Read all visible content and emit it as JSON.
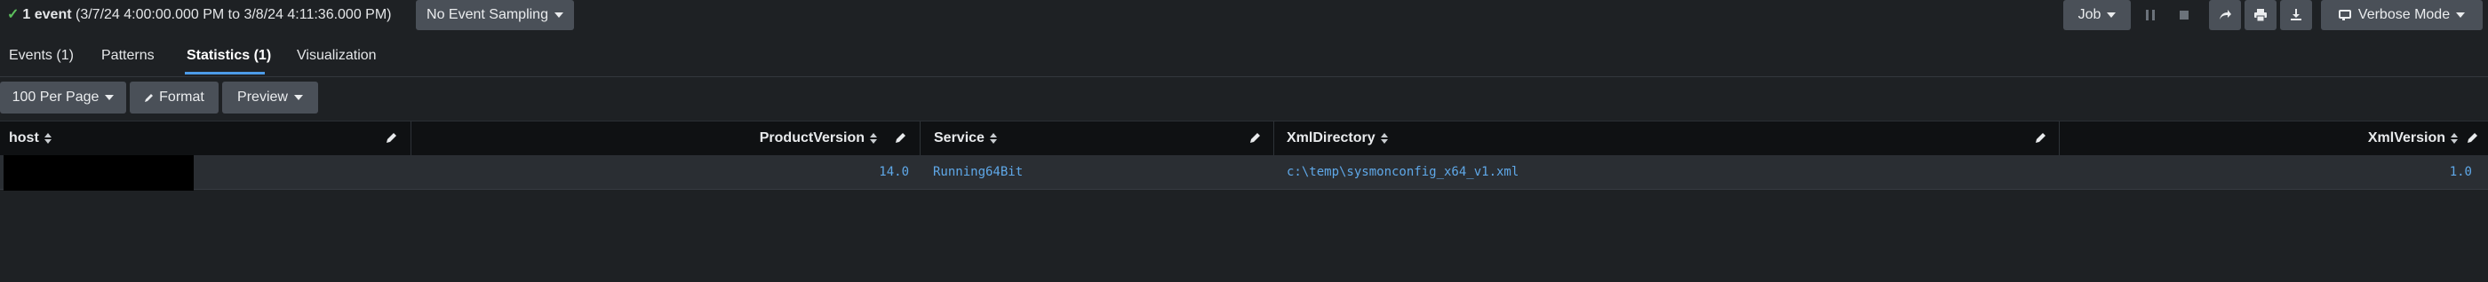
{
  "header": {
    "event_count": "1 event",
    "time_range": "(3/7/24 4:00:00.000 PM to 3/8/24 4:11:36.000 PM)",
    "sampling_label": "No Event Sampling",
    "job_label": "Job",
    "mode_label": "Verbose Mode"
  },
  "tabs": [
    {
      "label": "Events (1)"
    },
    {
      "label": "Patterns"
    },
    {
      "label": "Statistics (1)"
    },
    {
      "label": "Visualization"
    }
  ],
  "toolbar": {
    "per_page_label": "100 Per Page",
    "format_label": "Format",
    "preview_label": "Preview"
  },
  "table": {
    "columns": [
      "host",
      "ProductVersion",
      "Service",
      "XmlDirectory",
      "XmlVersion"
    ],
    "rows": [
      {
        "host": "",
        "ProductVersion": "14.0",
        "Service": "Running64Bit",
        "XmlDirectory": "c:\\temp\\sysmonconfig_x64_v1.xml",
        "XmlVersion": "1.0"
      }
    ]
  },
  "colors": {
    "background": "#1e2124",
    "button": "#4a5058",
    "link": "#5fa8e8",
    "active_tab_underline": "#4c9be8",
    "check": "#5cc05c"
  }
}
